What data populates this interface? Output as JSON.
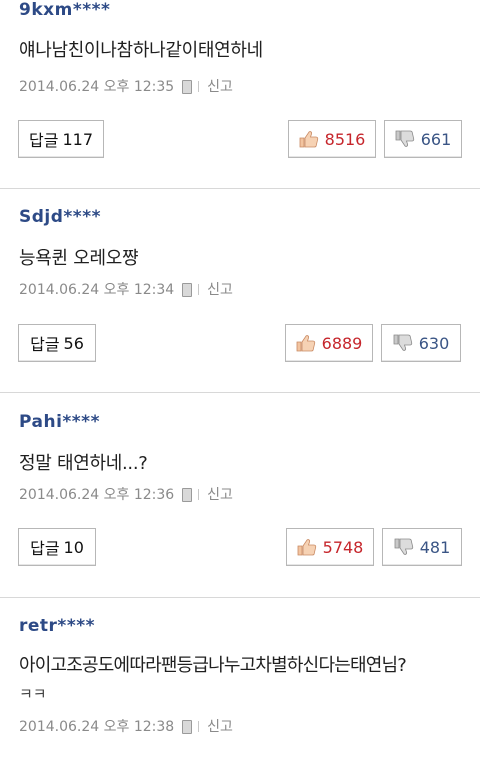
{
  "comments": [
    {
      "author": "9kxm****",
      "body": "얘나남친이나참하나같이태연하네",
      "body2": "",
      "date": "2014.06.24 오후 12:35",
      "report_label": "신고",
      "reply_label": "답글",
      "reply_count": "117",
      "likes": "8516",
      "dislikes": "661"
    },
    {
      "author": "Sdjd****",
      "body": "능욕퀸 오레오쨩",
      "body2": "",
      "date": "2014.06.24 오후 12:34",
      "report_label": "신고",
      "reply_label": "답글",
      "reply_count": "56",
      "likes": "6889",
      "dislikes": "630"
    },
    {
      "author": "Pahi****",
      "body": "정말 태연하네...?",
      "body2": "",
      "date": "2014.06.24 오후 12:36",
      "report_label": "신고",
      "reply_label": "답글",
      "reply_count": "10",
      "likes": "5748",
      "dislikes": "481"
    },
    {
      "author": "retr****",
      "body": "아이고조공도에따라팬등급나누고차별하신다는태연님?",
      "body2": "ㅋㅋ",
      "date": "2014.06.24 오후 12:38",
      "report_label": "신고"
    }
  ],
  "colors": {
    "author": "#2d4a86",
    "like": "#c6262c",
    "dislike": "#3a5585",
    "meta": "#8a8a8a",
    "divider": "#d8d8d8"
  },
  "icons": {
    "like": "thumbs-up-icon",
    "dislike": "thumbs-down-icon",
    "device": "mobile-phone-icon"
  }
}
